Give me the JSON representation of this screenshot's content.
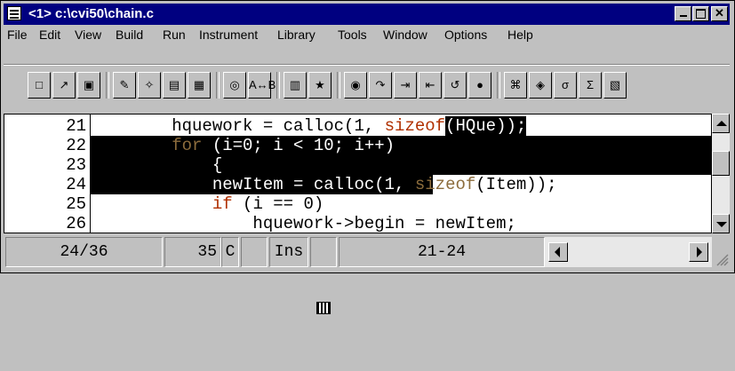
{
  "window": {
    "title": "<1> c:\\cvi50\\chain.c",
    "controls": [
      "minimize",
      "maximize",
      "close"
    ]
  },
  "menubar": {
    "items": [
      "File",
      "Edit",
      "View",
      "Build",
      "Run",
      "Instrument",
      "Library",
      "Tools",
      "Window",
      "Options",
      "Help"
    ]
  },
  "toolbar": {
    "buttons": [
      {
        "icon": "new-file-icon",
        "glyph": "□"
      },
      {
        "icon": "open-folder-icon",
        "glyph": "↗"
      },
      {
        "icon": "save-disk-icon",
        "glyph": "▣"
      },
      {
        "icon": "edit-panel-icon",
        "glyph": "✎"
      },
      {
        "icon": "recall-function-icon",
        "glyph": "✧"
      },
      {
        "icon": "project-icon",
        "glyph": "▤"
      },
      {
        "icon": "window-icon",
        "glyph": "▦"
      },
      {
        "icon": "find-binoculars-icon",
        "glyph": "◎"
      },
      {
        "icon": "find-replace-icon",
        "glyph": "A↔B"
      },
      {
        "icon": "build-icon",
        "glyph": "▥"
      },
      {
        "icon": "run-icon",
        "glyph": "★"
      },
      {
        "icon": "go-icon",
        "glyph": "◉"
      },
      {
        "icon": "step-into-icon",
        "glyph": "↷"
      },
      {
        "icon": "step-over-icon",
        "glyph": "⇥"
      },
      {
        "icon": "step-out-icon",
        "glyph": "⇤"
      },
      {
        "icon": "finish-function-icon",
        "glyph": "↺"
      },
      {
        "icon": "terminate-icon",
        "glyph": "●"
      },
      {
        "icon": "watch-icon",
        "glyph": "⌘"
      },
      {
        "icon": "breakpoint-icon",
        "glyph": "◈"
      },
      {
        "icon": "variables-icon",
        "glyph": "σ"
      },
      {
        "icon": "expression-icon",
        "glyph": "Σ"
      },
      {
        "icon": "clipboard-icon",
        "glyph": "▧"
      }
    ]
  },
  "editor": {
    "lines": [
      {
        "num": "21",
        "parts": [
          {
            "t": "        hquework = calloc(1, ",
            "c": "normal"
          },
          {
            "t": "sizeof",
            "c": "kw"
          },
          {
            "t": "(HQue));",
            "c": "hi"
          }
        ]
      },
      {
        "num": "22",
        "parts": [
          {
            "t": "        for",
            "c": "kwsel"
          },
          {
            "t": " (i=0; i < 10; i++)",
            "c": "sel"
          }
        ]
      },
      {
        "num": "23",
        "parts": [
          {
            "t": "            {",
            "c": "sel"
          }
        ]
      },
      {
        "num": "24",
        "parts": [
          {
            "t": "            newItem = calloc(1, ",
            "c": "sel"
          },
          {
            "t": "sizeof",
            "c": "kwsel"
          },
          {
            "t": "(Item));",
            "c": "normal"
          }
        ]
      },
      {
        "num": "25",
        "parts": [
          {
            "t": "            ",
            "c": "normal"
          },
          {
            "t": "if",
            "c": "kw"
          },
          {
            "t": " (i == 0)",
            "c": "normal"
          }
        ]
      },
      {
        "num": "26",
        "parts": [
          {
            "t": "                hquework->begin = newItem;",
            "c": "normal"
          }
        ]
      }
    ]
  },
  "status": {
    "position": "24/36",
    "column": "35",
    "mode_c": "C",
    "ins": "Ins",
    "selection_range": "21-24"
  },
  "colors": {
    "titlebar": "#000080",
    "selection": "#000000",
    "keyword": "#b03000"
  }
}
